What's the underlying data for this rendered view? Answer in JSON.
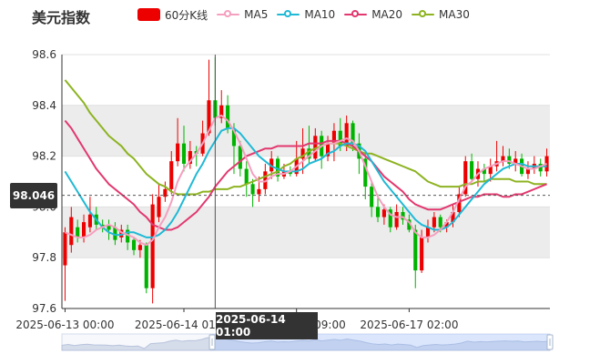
{
  "chart_data": {
    "type": "candlestick",
    "title": "美元指数",
    "legend": [
      {
        "name": "60分K线",
        "kind": "rect",
        "color": "#ec0000"
      },
      {
        "name": "MA5",
        "kind": "line",
        "color": "#f59fbf"
      },
      {
        "name": "MA10",
        "kind": "line",
        "color": "#1fb9d5"
      },
      {
        "name": "MA20",
        "kind": "line",
        "color": "#e2386f"
      },
      {
        "name": "MA30",
        "kind": "line",
        "color": "#8db321"
      }
    ],
    "y_ticks": [
      "97.6",
      "97.8",
      "98.0",
      "98.2",
      "98.4",
      "98.6"
    ],
    "ylim": [
      97.6,
      98.6
    ],
    "x_ticks": [
      {
        "label": "2025-06-13 00:00",
        "index": 0
      },
      {
        "label": "2025-06-14 01:00",
        "index": 19
      },
      {
        "label": "2025-06-16 09:00",
        "index": 37
      },
      {
        "label": "2025-06-17 02:00",
        "index": 55
      }
    ],
    "grid": "horizontal bands",
    "candles": [
      [
        97.77,
        97.9,
        97.92,
        97.63
      ],
      [
        97.85,
        97.96,
        98.0,
        97.82
      ],
      [
        97.92,
        97.88,
        97.95,
        97.86
      ],
      [
        97.88,
        97.94,
        97.97,
        97.86
      ],
      [
        97.92,
        97.97,
        98.04,
        97.9
      ],
      [
        97.97,
        97.93,
        98.0,
        97.91
      ],
      [
        97.93,
        97.92,
        97.95,
        97.9
      ],
      [
        97.93,
        97.91,
        97.95,
        97.87
      ],
      [
        97.92,
        97.87,
        97.94,
        97.85
      ],
      [
        97.88,
        97.91,
        97.93,
        97.86
      ],
      [
        97.91,
        97.86,
        97.93,
        97.83
      ],
      [
        97.87,
        97.83,
        97.88,
        97.81
      ],
      [
        97.83,
        97.85,
        97.87,
        97.8
      ],
      [
        97.85,
        97.68,
        97.86,
        97.66
      ],
      [
        97.68,
        98.01,
        98.05,
        97.62
      ],
      [
        97.96,
        98.04,
        98.09,
        97.94
      ],
      [
        98.04,
        98.07,
        98.1,
        98.02
      ],
      [
        98.07,
        98.18,
        98.22,
        98.05
      ],
      [
        98.18,
        98.25,
        98.35,
        98.16
      ],
      [
        98.25,
        98.17,
        98.32,
        98.14
      ],
      [
        98.17,
        98.22,
        98.26,
        98.15
      ],
      [
        98.22,
        98.21,
        98.24,
        98.16
      ],
      [
        98.21,
        98.29,
        98.34,
        98.2
      ],
      [
        98.29,
        98.42,
        98.58,
        98.28
      ],
      [
        98.42,
        98.35,
        98.59,
        98.32
      ],
      [
        98.35,
        98.4,
        98.46,
        98.33
      ],
      [
        98.4,
        98.31,
        98.44,
        98.29
      ],
      [
        98.31,
        98.24,
        98.33,
        98.13
      ],
      [
        98.24,
        98.15,
        98.26,
        98.12
      ],
      [
        98.15,
        98.09,
        98.18,
        98.04
      ],
      [
        98.09,
        98.05,
        98.11,
        98.0
      ],
      [
        98.05,
        98.07,
        98.12,
        98.02
      ],
      [
        98.07,
        98.14,
        98.17,
        98.05
      ],
      [
        98.14,
        98.19,
        98.22,
        98.11
      ],
      [
        98.19,
        98.12,
        98.2,
        98.1
      ],
      [
        98.12,
        98.14,
        98.17,
        98.11
      ],
      [
        98.14,
        98.13,
        98.16,
        98.12
      ],
      [
        98.13,
        98.19,
        98.26,
        98.12
      ],
      [
        98.19,
        98.23,
        98.31,
        98.13
      ],
      [
        98.23,
        98.19,
        98.32,
        98.17
      ],
      [
        98.19,
        98.28,
        98.31,
        98.18
      ],
      [
        98.28,
        98.2,
        98.3,
        98.15
      ],
      [
        98.2,
        98.25,
        98.28,
        98.18
      ],
      [
        98.25,
        98.3,
        98.33,
        98.18
      ],
      [
        98.3,
        98.24,
        98.35,
        98.22
      ],
      [
        98.24,
        98.33,
        98.36,
        98.22
      ],
      [
        98.33,
        98.25,
        98.34,
        98.22
      ],
      [
        98.25,
        98.19,
        98.29,
        98.13
      ],
      [
        98.19,
        98.08,
        98.22,
        98.03
      ],
      [
        98.08,
        98.0,
        98.1,
        97.96
      ],
      [
        98.0,
        97.96,
        98.05,
        97.94
      ],
      [
        97.96,
        97.99,
        98.01,
        97.93
      ],
      [
        97.99,
        97.92,
        98.0,
        97.9
      ],
      [
        97.92,
        97.98,
        98.01,
        97.91
      ],
      [
        97.98,
        97.95,
        98.0,
        97.93
      ],
      [
        97.95,
        97.91,
        97.97,
        97.9
      ],
      [
        97.91,
        97.75,
        97.93,
        97.68
      ],
      [
        97.75,
        97.88,
        97.91,
        97.74
      ],
      [
        97.88,
        97.92,
        97.95,
        97.86
      ],
      [
        97.92,
        97.96,
        97.98,
        97.9
      ],
      [
        97.96,
        97.92,
        97.97,
        97.9
      ],
      [
        97.92,
        97.94,
        97.95,
        97.9
      ],
      [
        97.94,
        97.98,
        98.01,
        97.92
      ],
      [
        97.98,
        98.05,
        98.08,
        97.96
      ],
      [
        98.05,
        98.18,
        98.2,
        98.04
      ],
      [
        98.18,
        98.11,
        98.21,
        98.1
      ],
      [
        98.11,
        98.15,
        98.18,
        98.08
      ],
      [
        98.15,
        98.13,
        98.17,
        98.1
      ],
      [
        98.13,
        98.16,
        98.19,
        98.1
      ],
      [
        98.16,
        98.18,
        98.26,
        98.14
      ],
      [
        98.18,
        98.2,
        98.24,
        98.16
      ],
      [
        98.2,
        98.17,
        98.23,
        98.15
      ],
      [
        98.17,
        98.19,
        98.22,
        98.14
      ],
      [
        98.19,
        98.13,
        98.21,
        98.12
      ],
      [
        98.13,
        98.15,
        98.18,
        98.11
      ],
      [
        98.15,
        98.17,
        98.2,
        98.13
      ],
      [
        98.17,
        98.14,
        98.19,
        98.12
      ],
      [
        98.14,
        98.2,
        98.23,
        98.12
      ]
    ],
    "ma5": [
      97.9,
      97.89,
      97.88,
      97.88,
      97.89,
      97.91,
      97.92,
      97.93,
      97.92,
      97.9,
      97.89,
      97.88,
      97.86,
      97.85,
      97.87,
      97.92,
      97.96,
      98.02,
      98.1,
      98.15,
      98.18,
      98.21,
      98.25,
      98.3,
      98.35,
      98.36,
      98.34,
      98.3,
      98.25,
      98.19,
      98.13,
      98.1,
      98.1,
      98.12,
      98.13,
      98.13,
      98.14,
      98.16,
      98.18,
      98.2,
      98.22,
      98.24,
      98.25,
      98.25,
      98.26,
      98.27,
      98.26,
      98.22,
      98.16,
      98.1,
      98.04,
      98.0,
      97.97,
      97.96,
      97.96,
      97.94,
      97.9,
      97.88,
      97.88,
      97.89,
      97.91,
      97.94,
      97.98,
      98.03,
      98.08,
      98.1,
      98.13,
      98.15,
      98.16,
      98.17,
      98.18,
      98.18,
      98.17,
      98.16,
      98.15,
      98.15,
      98.16,
      98.17
    ],
    "ma10": [
      98.14,
      98.1,
      98.06,
      98.02,
      97.98,
      97.95,
      97.92,
      97.9,
      97.89,
      97.89,
      97.9,
      97.9,
      97.89,
      97.88,
      97.88,
      97.89,
      97.91,
      97.94,
      97.98,
      98.03,
      98.08,
      98.13,
      98.17,
      98.22,
      98.26,
      98.3,
      98.31,
      98.31,
      98.29,
      98.26,
      98.23,
      98.2,
      98.18,
      98.16,
      98.15,
      98.14,
      98.14,
      98.14,
      98.15,
      98.17,
      98.18,
      98.19,
      98.21,
      98.22,
      98.24,
      98.25,
      98.25,
      98.24,
      98.22,
      98.18,
      98.14,
      98.1,
      98.07,
      98.04,
      98.01,
      97.98,
      97.95,
      97.93,
      97.92,
      97.91,
      97.91,
      97.92,
      97.94,
      97.97,
      98.0,
      98.03,
      98.06,
      98.09,
      98.11,
      98.13,
      98.15,
      98.16,
      98.17,
      98.17,
      98.16,
      98.16,
      98.16,
      98.16
    ],
    "ma20": [
      98.34,
      98.31,
      98.27,
      98.23,
      98.19,
      98.15,
      98.12,
      98.09,
      98.07,
      98.05,
      98.03,
      98.01,
      97.98,
      97.96,
      97.93,
      97.92,
      97.91,
      97.91,
      97.92,
      97.94,
      97.96,
      97.98,
      98.01,
      98.04,
      98.08,
      98.11,
      98.14,
      98.16,
      98.18,
      98.2,
      98.21,
      98.22,
      98.23,
      98.23,
      98.24,
      98.24,
      98.24,
      98.24,
      98.24,
      98.25,
      98.25,
      98.25,
      98.26,
      98.26,
      98.26,
      98.25,
      98.24,
      98.22,
      98.2,
      98.18,
      98.15,
      98.12,
      98.1,
      98.08,
      98.06,
      98.03,
      98.01,
      98.0,
      97.99,
      97.99,
      97.99,
      98.0,
      98.01,
      98.02,
      98.03,
      98.04,
      98.04,
      98.05,
      98.05,
      98.05,
      98.04,
      98.04,
      98.05,
      98.05,
      98.06,
      98.07,
      98.08,
      98.09
    ],
    "ma30": [
      98.5,
      98.47,
      98.44,
      98.41,
      98.37,
      98.34,
      98.31,
      98.28,
      98.26,
      98.24,
      98.21,
      98.19,
      98.16,
      98.13,
      98.11,
      98.09,
      98.08,
      98.06,
      98.05,
      98.05,
      98.05,
      98.05,
      98.06,
      98.06,
      98.07,
      98.07,
      98.07,
      98.08,
      98.08,
      98.09,
      98.1,
      98.11,
      98.12,
      98.13,
      98.14,
      98.16,
      98.17,
      98.19,
      98.2,
      98.22,
      98.23,
      98.24,
      98.25,
      98.25,
      98.25,
      98.24,
      98.23,
      98.22,
      98.21,
      98.21,
      98.2,
      98.19,
      98.18,
      98.17,
      98.16,
      98.15,
      98.14,
      98.12,
      98.1,
      98.09,
      98.08,
      98.08,
      98.08,
      98.08,
      98.09,
      98.09,
      98.1,
      98.1,
      98.11,
      98.11,
      98.11,
      98.11,
      98.1,
      98.1,
      98.1,
      98.09,
      98.09,
      98.09
    ],
    "pointer_value": "98.046",
    "pointer_price": 98.046,
    "hover_time": "2025-06-14 01:00",
    "hover_index": 24
  }
}
